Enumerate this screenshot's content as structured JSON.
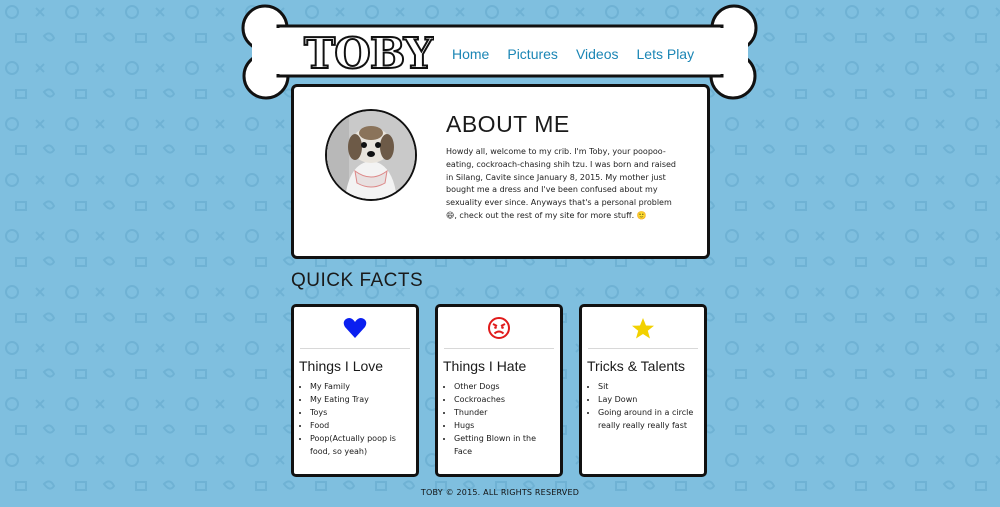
{
  "site": {
    "logo_text": "TOBY",
    "nav": [
      {
        "label": "Home"
      },
      {
        "label": "Pictures"
      },
      {
        "label": "Videos"
      },
      {
        "label": "Lets Play"
      }
    ]
  },
  "about": {
    "title": "ABOUT ME",
    "body": "Howdy all, welcome to my crib. I'm Toby, your poopoo-eating, cockroach-chasing shih tzu. I was born and raised in Silang, Cavite since January 8, 2015. My mother just bought me a dress and I've been confused about my sexuality ever since. Anyways that's a personal problem 😄, check out the rest of my site for more stuff. 🙂"
  },
  "quick_facts": {
    "title": "QUICK FACTS",
    "cards": [
      {
        "icon": "heart-icon",
        "icon_color": "#0a1ff0",
        "title": "Things I Love",
        "items": [
          "My Family",
          "My Eating Tray",
          "Toys",
          "Food",
          "Poop(Actually poop is food, so yeah)"
        ]
      },
      {
        "icon": "angry-face-icon",
        "icon_color": "#e01b1b",
        "title": "Things I Hate",
        "items": [
          "Other Dogs",
          "Cockroaches",
          "Thunder",
          "Hugs",
          "Getting Blown in the Face"
        ]
      },
      {
        "icon": "star-icon",
        "icon_color": "#f2d100",
        "title": "Tricks & Talents",
        "items": [
          "Sit",
          "Lay Down",
          "Going around in a circle really really really fast"
        ]
      }
    ]
  },
  "footer": {
    "text": "TOBY © 2015. ALL RIGHTS RESERVED"
  },
  "colors": {
    "background": "#7fbfdf",
    "nav_link": "#1b86b5",
    "pattern": "#6fb3d6"
  }
}
